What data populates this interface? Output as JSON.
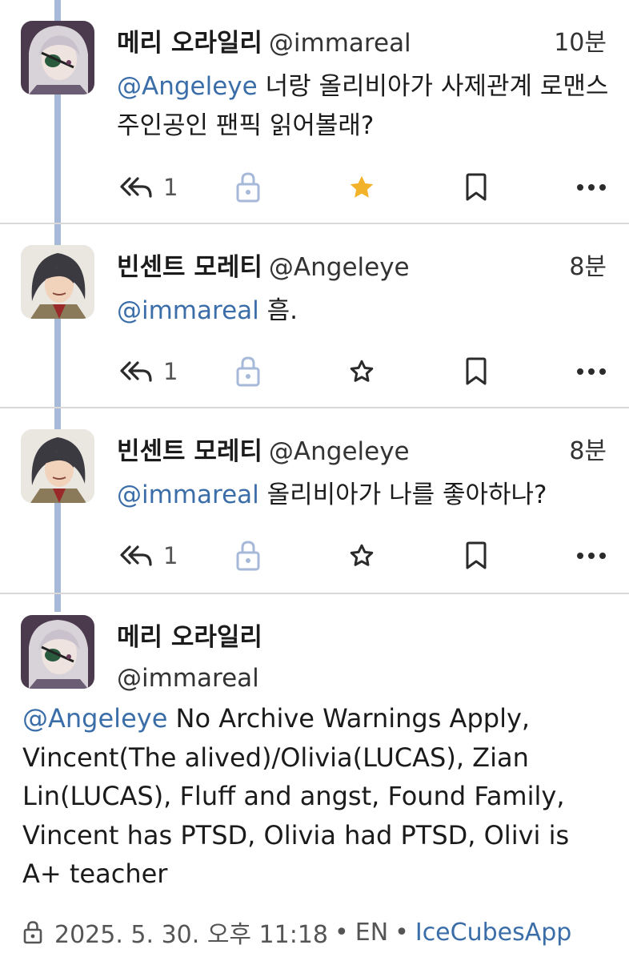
{
  "replies": [
    {
      "display_name": "메리 오라일리",
      "handle": "@immareal",
      "time": "10분",
      "mention": "@Angeleye",
      "text": " 너랑 올리비아가 사제관계 로맨스 주인공인 팬픽 읽어볼래?",
      "reply_count": "1",
      "favorited": true,
      "avatar": "white-haired-eyepatch-avatar"
    },
    {
      "display_name": "빈센트 모레티",
      "handle": "@Angeleye",
      "time": "8분",
      "mention": "@immareal",
      "text": " 흠.",
      "reply_count": "1",
      "favorited": false,
      "avatar": "dark-haired-man-avatar"
    },
    {
      "display_name": "빈센트 모레티",
      "handle": "@Angeleye",
      "time": "8분",
      "mention": "@immareal",
      "text": " 올리비아가 나를 좋아하나?",
      "reply_count": "1",
      "favorited": false,
      "avatar": "dark-haired-man-avatar"
    }
  ],
  "main_post": {
    "display_name": "메리 오라일리",
    "handle": "@immareal",
    "mention": "@Angeleye",
    "text": " No Archive Warnings Apply, Vincent(The alived)/Olivia(LUCAS), Zian Lin(LUCAS), Fluff and angst, Found Family, Vincent has PTSD, Olivia had PTSD, Olivi is A+ teacher",
    "date": "2025. 5. 30. 오후 11:18",
    "separator": "•",
    "language": "EN",
    "app": "IceCubesApp",
    "visibility_icon": "lock-icon"
  },
  "colors": {
    "thread_line": "#a6b9d8",
    "mention": "#3b6ea8",
    "star_active": "#f2b32a",
    "icon": "#2b2b2b",
    "lock_icon": "#a6b9d8"
  }
}
